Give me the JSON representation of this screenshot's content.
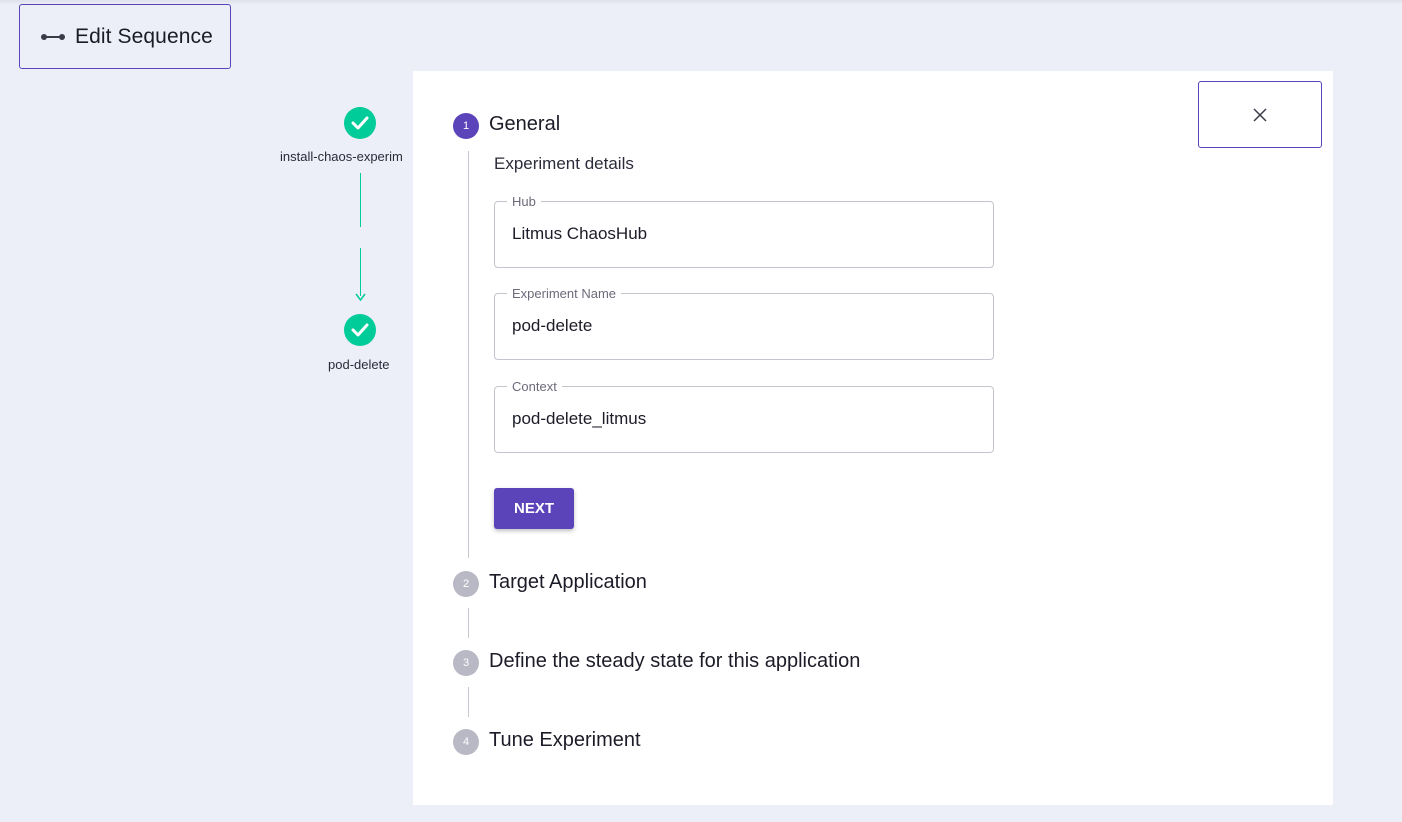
{
  "header": {
    "edit_sequence_label": "Edit Sequence",
    "edit_sequence_icon": "sequence-icon"
  },
  "sequence": {
    "nodes": [
      {
        "label": "install-chaos-experim",
        "status": "completed",
        "icon": "check-icon"
      },
      {
        "label": "pod-delete",
        "status": "completed",
        "icon": "check-icon"
      }
    ],
    "accent_color": "#00cc9a"
  },
  "stepper": {
    "steps": [
      {
        "number": "1",
        "title": "General",
        "active": true
      },
      {
        "number": "2",
        "title": "Target Application",
        "active": false
      },
      {
        "number": "3",
        "title": "Define the steady state for this application",
        "active": false
      },
      {
        "number": "4",
        "title": "Tune Experiment",
        "active": false
      }
    ],
    "general": {
      "section_title": "Experiment details",
      "fields": {
        "hub": {
          "label": "Hub",
          "value": "Litmus ChaosHub"
        },
        "experiment_name": {
          "label": "Experiment Name",
          "value": "pod-delete"
        },
        "context": {
          "label": "Context",
          "value": "pod-delete_litmus"
        }
      },
      "next_label": "NEXT"
    }
  },
  "close_icon": "close-icon",
  "colors": {
    "primary": "#5b44ba",
    "success": "#00cc9a",
    "inactive_step": "#b9b9c6",
    "background": "#eceef8"
  }
}
